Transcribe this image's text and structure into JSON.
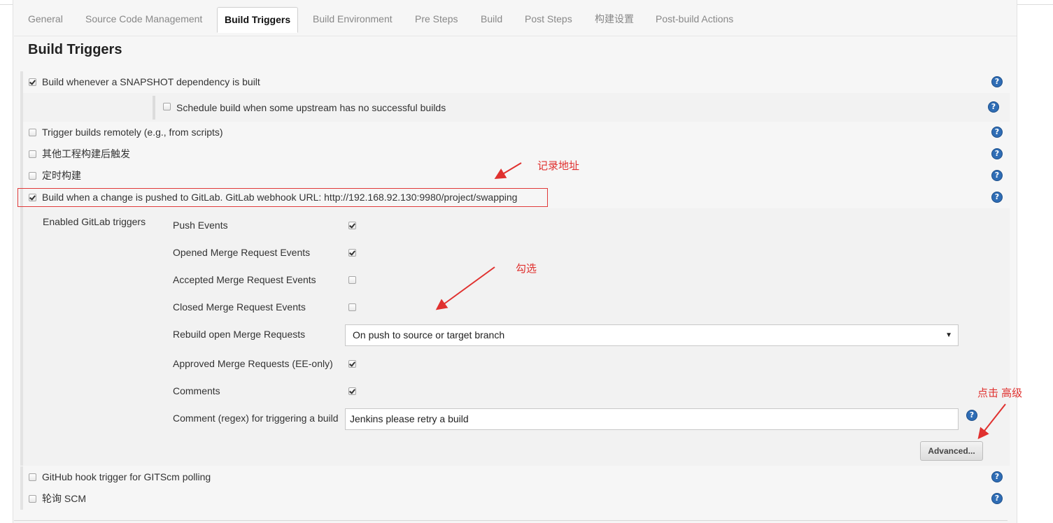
{
  "tabs": [
    {
      "label": "General"
    },
    {
      "label": "Source Code Management"
    },
    {
      "label": "Build Triggers"
    },
    {
      "label": "Build Environment"
    },
    {
      "label": "Pre Steps"
    },
    {
      "label": "Build"
    },
    {
      "label": "Post Steps"
    },
    {
      "label": "构建设置"
    },
    {
      "label": "Post-build Actions"
    }
  ],
  "active_tab": "Build Triggers",
  "page_title": "Build Triggers",
  "triggers": {
    "snapshot": {
      "label": "Build whenever a SNAPSHOT dependency is built",
      "checked": true
    },
    "upstream": {
      "label": "Schedule build when some upstream has no successful builds",
      "checked": false
    },
    "remote": {
      "label": "Trigger builds remotely (e.g., from scripts)",
      "checked": false
    },
    "other_project": {
      "label": "其他工程构建后触发",
      "checked": false
    },
    "periodic": {
      "label": "定时构建",
      "checked": false
    },
    "gitlab": {
      "label": "Build when a change is pushed to GitLab. GitLab webhook URL: http://192.168.92.130:9980/project/swapping",
      "checked": true
    },
    "github": {
      "label": "GitHub hook trigger for GITScm polling",
      "checked": false
    },
    "scm_poll": {
      "label": "轮询 SCM",
      "checked": false
    }
  },
  "gitlab": {
    "section_label": "Enabled GitLab triggers",
    "push_events": {
      "label": "Push Events",
      "checked": true
    },
    "opened_mr": {
      "label": "Opened Merge Request Events",
      "checked": true
    },
    "accepted_mr": {
      "label": "Accepted Merge Request Events",
      "checked": false
    },
    "closed_mr": {
      "label": "Closed Merge Request Events",
      "checked": false
    },
    "rebuild": {
      "label": "Rebuild open Merge Requests",
      "value": "On push to source or target branch"
    },
    "approved_mr": {
      "label": "Approved Merge Requests (EE-only)",
      "checked": true
    },
    "comments": {
      "label": "Comments",
      "checked": true
    },
    "comment_regex": {
      "label": "Comment (regex) for triggering a build",
      "value": "Jenkins please retry a build"
    },
    "advanced_label": "Advanced..."
  },
  "help_glyph": "?",
  "annotations": {
    "record_url": "记录地址",
    "check": "勾选",
    "click_advanced": "点击 高级",
    "color": "#e0312f"
  }
}
